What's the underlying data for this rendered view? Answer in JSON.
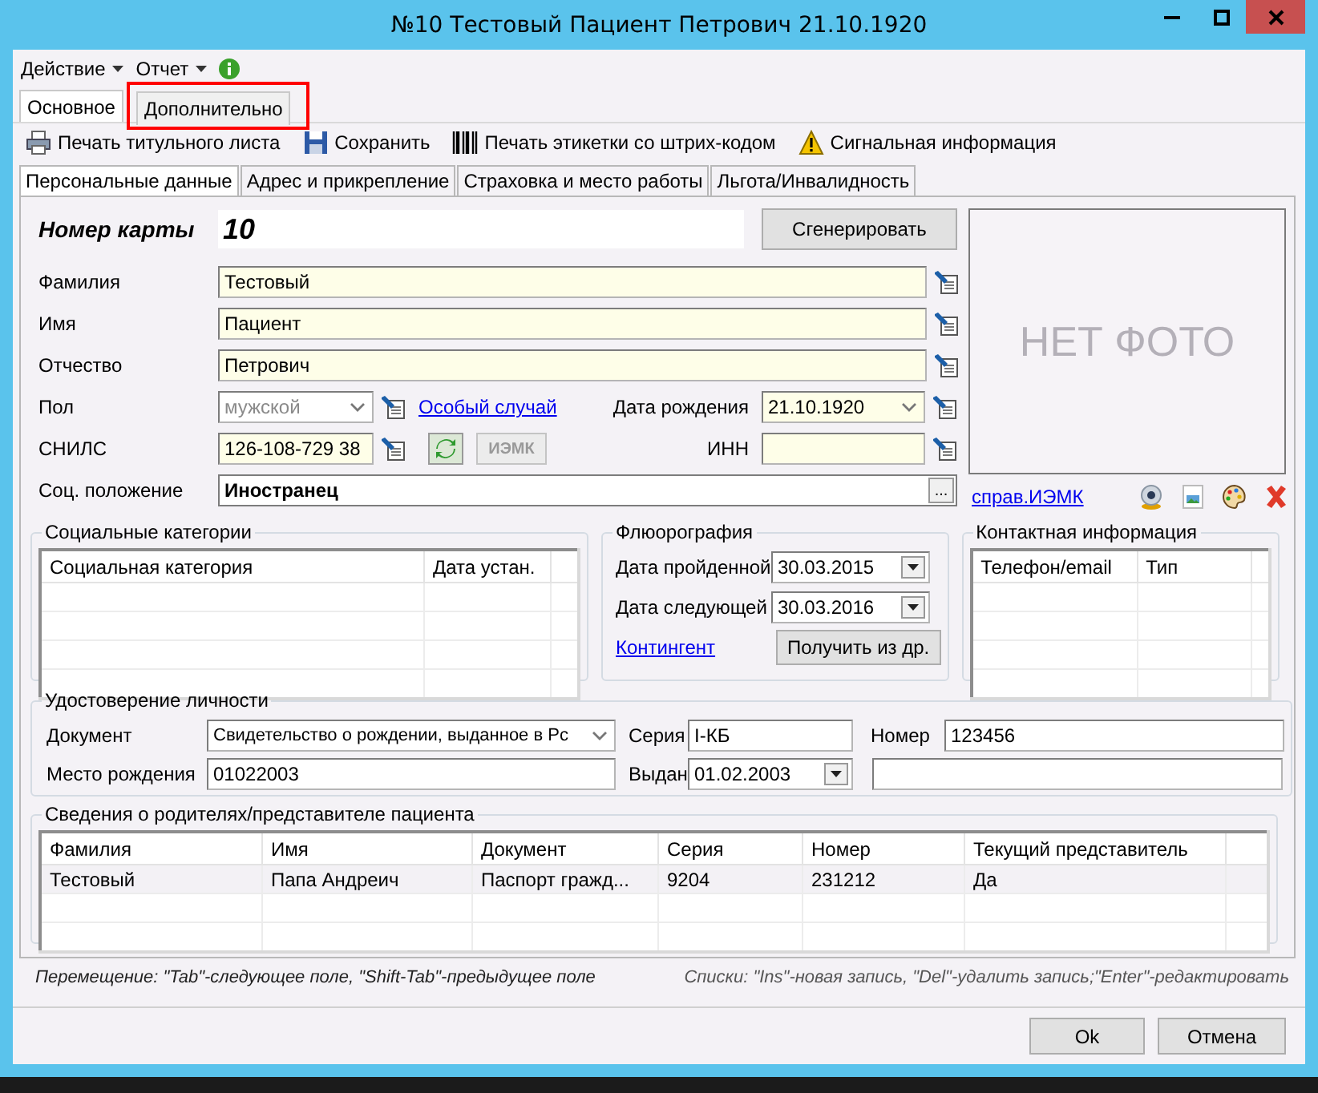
{
  "window": {
    "title": "№10 Тестовый Пациент Петрович 21.10.1920"
  },
  "menu": [
    "Действие",
    "Отчет"
  ],
  "tabs": [
    {
      "label": "Основное",
      "selected": true,
      "highlighted": false
    },
    {
      "label": "Дополнительно",
      "selected": false,
      "highlighted": true
    }
  ],
  "toolbar": [
    "Печать титульного листа",
    "Сохранить",
    "Печать этикетки со штрих-кодом",
    "Сигнальная информация"
  ],
  "subtabs": [
    {
      "label": "Персональные данные",
      "selected": true
    },
    {
      "label": "Адрес и прикрепление",
      "selected": false
    },
    {
      "label": "Страховка и место работы",
      "selected": false
    },
    {
      "label": "Льгота/Инвалидность",
      "selected": false
    }
  ],
  "card": {
    "label": "Номер карты",
    "value": "10",
    "button": "Сгенерировать"
  },
  "name_fields": [
    {
      "label": "Фамилия",
      "value": "Тестовый"
    },
    {
      "label": "Имя",
      "value": "Пациент"
    },
    {
      "label": "Отчество",
      "value": "Петрович"
    }
  ],
  "sex": {
    "label": "Пол",
    "value": "мужской",
    "disabled": true
  },
  "special_case_link": "Особый случай",
  "birth_date": {
    "label": "Дата рождения",
    "value": "21.10.1920"
  },
  "snils": {
    "label": "СНИЛС",
    "value": "126-108-729 38"
  },
  "iemk_button": {
    "label": "ИЭМК",
    "disabled": true
  },
  "inn": {
    "label": "ИНН"
  },
  "social_status": {
    "label": "Соц. положение",
    "value": "Иностранец",
    "button": "..."
  },
  "photo": {
    "caption": "НЕТ ФОТО"
  },
  "iemk_link": "справ.ИЭМК",
  "social_categories": {
    "title": "Социальные категории",
    "columns": [
      "Социальная категория",
      "Дата устан."
    ]
  },
  "fluorography": {
    "title": "Флюорография",
    "fields": [
      {
        "label": "Дата пройденной",
        "value": "30.03.2015"
      },
      {
        "label": "Дата следующей",
        "value": "30.03.2016"
      }
    ],
    "link": "Контингент",
    "button": "Получить из др."
  },
  "contacts": {
    "title": "Контактная информация",
    "columns": [
      "Телефон/email",
      "Тип"
    ]
  },
  "identity": {
    "title": "Удостоверение личности",
    "document": {
      "label": "Документ",
      "value": "Свидетельство о рождении, выданное в Рс"
    },
    "series": {
      "label": "Серия",
      "value": "I-КБ"
    },
    "number": {
      "label": "Номер",
      "value": "123456"
    },
    "birthplace": {
      "label": "Место рождения",
      "value": "01022003"
    },
    "issued": {
      "label": "Выдан",
      "value": "01.02.2003"
    }
  },
  "parents": {
    "title": "Сведения о родителях/представителе пациента",
    "columns": [
      "Фамилия",
      "Имя",
      "Документ",
      "Серия",
      "Номер",
      "Текущий представитель"
    ],
    "rows": [
      [
        "Тестовый",
        "Папа Андреич",
        "Паспорт гражд...",
        "9204",
        "231212",
        "Да"
      ]
    ]
  },
  "hints": [
    "Перемещение: \"Tab\"-следующее поле, \"Shift-Tab\"-предыдущее поле",
    "Списки: \"Ins\"-новая запись, \"Del\"-удалить запись;\"Enter\"-редактировать"
  ],
  "buttons": [
    "Ok",
    "Отмена"
  ]
}
